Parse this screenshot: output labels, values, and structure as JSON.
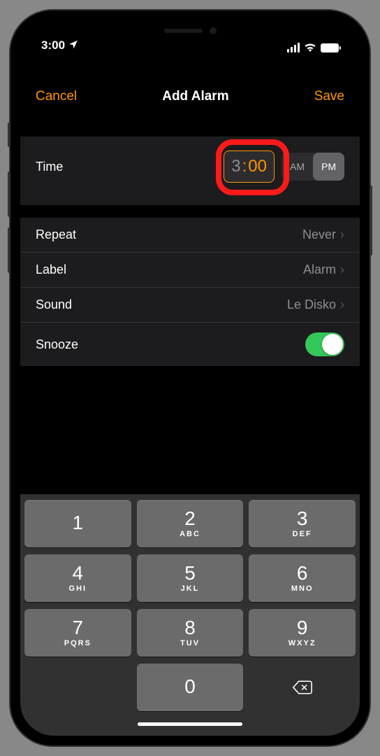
{
  "status": {
    "time": "3:00",
    "wifi": true
  },
  "nav": {
    "cancel": "Cancel",
    "title": "Add Alarm",
    "save": "Save"
  },
  "time_row": {
    "label": "Time",
    "hour": "3",
    "minute": "00",
    "am": "AM",
    "pm": "PM",
    "selected_period": "PM"
  },
  "settings": {
    "repeat": {
      "label": "Repeat",
      "value": "Never"
    },
    "label": {
      "label": "Label",
      "value": "Alarm"
    },
    "sound": {
      "label": "Sound",
      "value": "Le Disko"
    },
    "snooze": {
      "label": "Snooze",
      "on": true
    }
  },
  "keyboard": {
    "keys": [
      [
        "1",
        ""
      ],
      [
        "2",
        "ABC"
      ],
      [
        "3",
        "DEF"
      ],
      [
        "4",
        "GHI"
      ],
      [
        "5",
        "JKL"
      ],
      [
        "6",
        "MNO"
      ],
      [
        "7",
        "PQRS"
      ],
      [
        "8",
        "TUV"
      ],
      [
        "9",
        "WXYZ"
      ],
      [
        "",
        ""
      ],
      [
        "0",
        ""
      ],
      [
        "⌫",
        ""
      ]
    ]
  }
}
